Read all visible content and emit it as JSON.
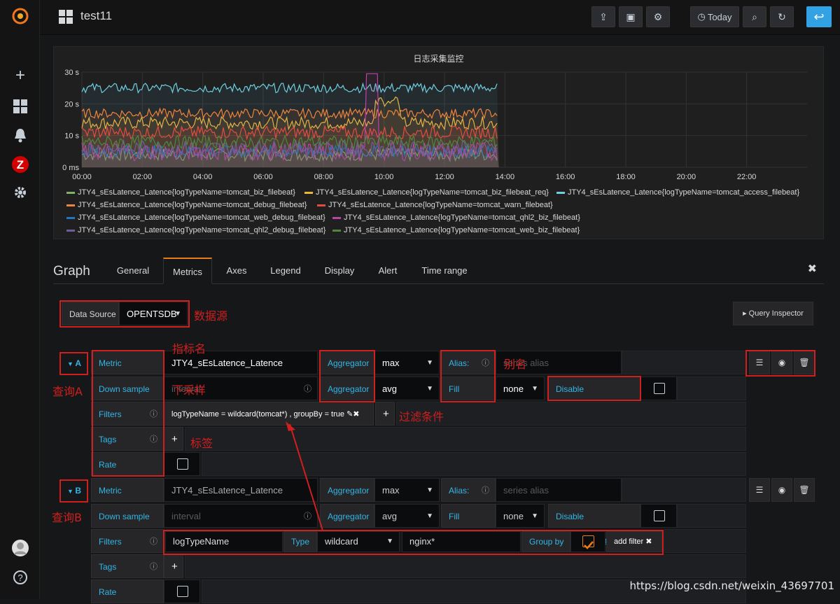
{
  "topnav": {
    "dashboard_title": "test11",
    "today_label": "Today"
  },
  "panel": {
    "title": "日志采集监控",
    "chart_data": {
      "type": "line",
      "title": "日志采集监控",
      "xlabel": "",
      "ylabel": "",
      "x_ticks": [
        "00:00",
        "02:00",
        "04:00",
        "06:00",
        "08:00",
        "10:00",
        "12:00",
        "14:00",
        "16:00",
        "18:00",
        "20:00",
        "22:00"
      ],
      "y_ticks": [
        "0 ms",
        "10 s",
        "20 s",
        "30 s"
      ],
      "ylim": [
        0,
        30
      ],
      "x_range_hours": [
        0,
        24
      ],
      "series": [
        {
          "name": "JTY4_sEsLatence_Latence{logTypeName=tomcat_biz_filebeat}",
          "color": "#7eb26d",
          "base": 4,
          "jitter": 2
        },
        {
          "name": "JTY4_sEsLatence_Latence{logTypeName=tomcat_biz_filebeat_req}",
          "color": "#eab839",
          "base": 14,
          "jitter": 2
        },
        {
          "name": "JTY4_sEsLatence_Latence{logTypeName=tomcat_access_filebeat}",
          "color": "#6ed0e0",
          "base": 25,
          "jitter": 1.5
        },
        {
          "name": "JTY4_sEsLatence_Latence{logTypeName=tomcat_debug_filebeat}",
          "color": "#ef843c",
          "base": 17,
          "jitter": 1.5
        },
        {
          "name": "JTY4_sEsLatence_Latence{logTypeName=tomcat_warn_filebeat}",
          "color": "#e24d42",
          "base": 11,
          "jitter": 2
        },
        {
          "name": "JTY4_sEsLatence_Latence{logTypeName=tomcat_web_debug_filebeat}",
          "color": "#1f78c1",
          "base": 5,
          "jitter": 2
        },
        {
          "name": "JTY4_sEsLatence_Latence{logTypeName=tomcat_qhl2_biz_filebeat}",
          "color": "#ba43a9",
          "base": 5,
          "jitter": 3
        },
        {
          "name": "JTY4_sEsLatence_Latence{logTypeName=tomcat_qhl2_debug_filebeat}",
          "color": "#705da0",
          "base": 6,
          "jitter": 2.5
        },
        {
          "name": "JTY4_sEsLatence_Latence{logTypeName=tomcat_web_biz_filebeat}",
          "color": "#508642",
          "base": 8,
          "jitter": 2
        }
      ],
      "end_hour": 13.8
    }
  },
  "editor": {
    "title": "Graph",
    "tabs": [
      "General",
      "Metrics",
      "Axes",
      "Legend",
      "Display",
      "Alert",
      "Time range"
    ],
    "active_tab": "Metrics",
    "datasource_label": "Data Source",
    "datasource_value": "OPENTSDB",
    "query_inspector": "Query Inspector",
    "query_a": {
      "ref": "A",
      "metric_label": "Metric",
      "metric_value": "JTY4_sEsLatence_Latence",
      "aggregator_label": "Aggregator",
      "aggregator_value": "max",
      "alias_label": "Alias:",
      "alias_placeholder": "series alias",
      "downsample_label": "Down sample",
      "downsample_placeholder": "interval",
      "aggregator2_label": "Aggregator",
      "aggregator2_value": "avg",
      "fill_label": "Fill",
      "fill_value": "none",
      "disable_downsampling": "Disable downsampling",
      "filters_label": "Filters",
      "filter_text": "logTypeName = wildcard(tomcat*) , groupBy = true",
      "tags_label": "Tags",
      "rate_label": "Rate"
    },
    "query_b": {
      "ref": "B",
      "metric_label": "Metric",
      "metric_value": "JTY4_sEsLatence_Latence",
      "aggregator_label": "Aggregator",
      "aggregator_value": "max",
      "alias_label": "Alias:",
      "alias_placeholder": "series alias",
      "downsample_label": "Down sample",
      "downsample_placeholder": "interval",
      "aggregator2_label": "Aggregator",
      "aggregator2_value": "avg",
      "fill_label": "Fill",
      "fill_value": "none",
      "disable_downsampling": "Disable downsampling",
      "filters_label": "Filters",
      "filter_tagk": "logTypeName",
      "type_label": "Type",
      "type_value": "wildcard",
      "filter_value": "nginx*",
      "groupby_label": "Group by",
      "add_filter": "add filter",
      "tags_label": "Tags",
      "rate_label": "Rate"
    }
  },
  "annotations": {
    "datasource": "数据源",
    "metric_name": "指标名",
    "alias": "别名",
    "downsample": "下采样",
    "query_a": "查询A",
    "filters": "过滤条件",
    "tags": "标签",
    "query_b": "查询B"
  },
  "watermark": "https://blog.csdn.net/weixin_43697701"
}
